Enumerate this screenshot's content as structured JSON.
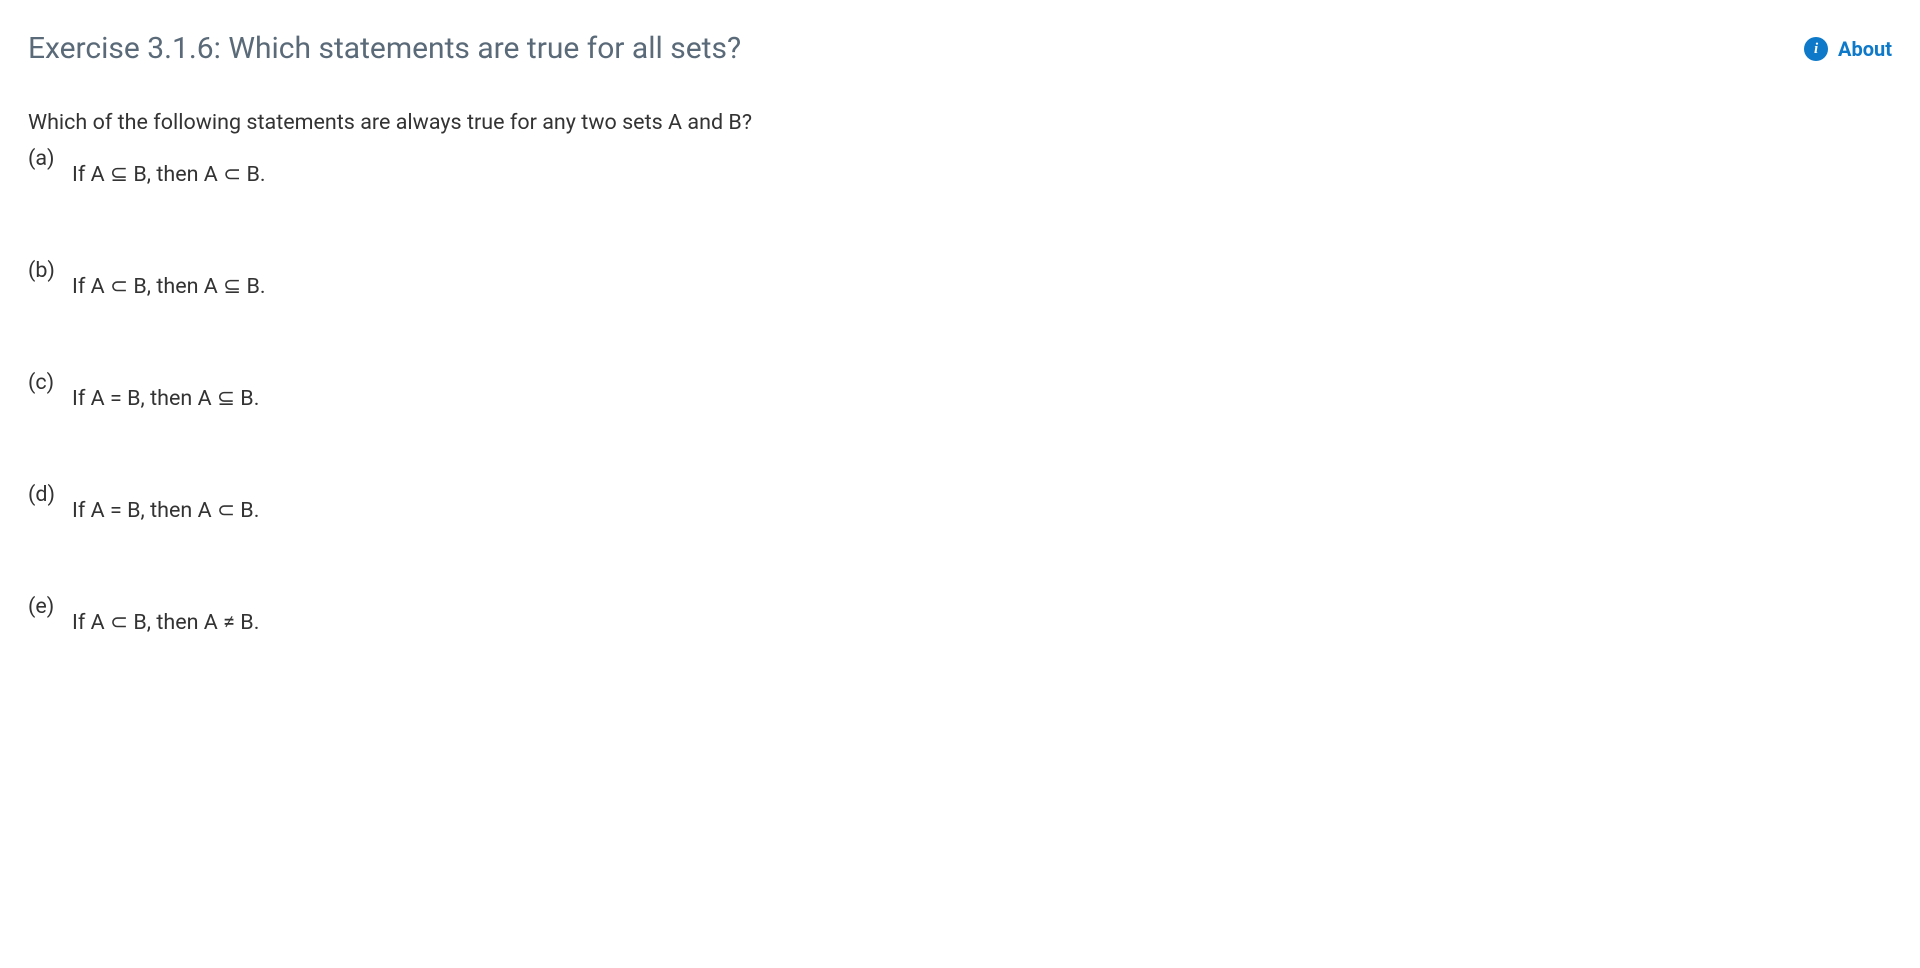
{
  "header": {
    "title": "Exercise 3.1.6: Which statements are true for all sets?",
    "about_label": "About"
  },
  "question": "Which of the following statements are always true for any two sets A and B?",
  "options": [
    {
      "label": "(a)",
      "text": "If A ⊆ B, then A ⊂ B."
    },
    {
      "label": "(b)",
      "text": "If A ⊂ B, then A ⊆ B."
    },
    {
      "label": "(c)",
      "text": "If A = B, then A ⊆ B."
    },
    {
      "label": "(d)",
      "text": "If A = B, then A ⊂ B."
    },
    {
      "label": "(e)",
      "text": "If A ⊂ B, then A ≠ B."
    }
  ]
}
